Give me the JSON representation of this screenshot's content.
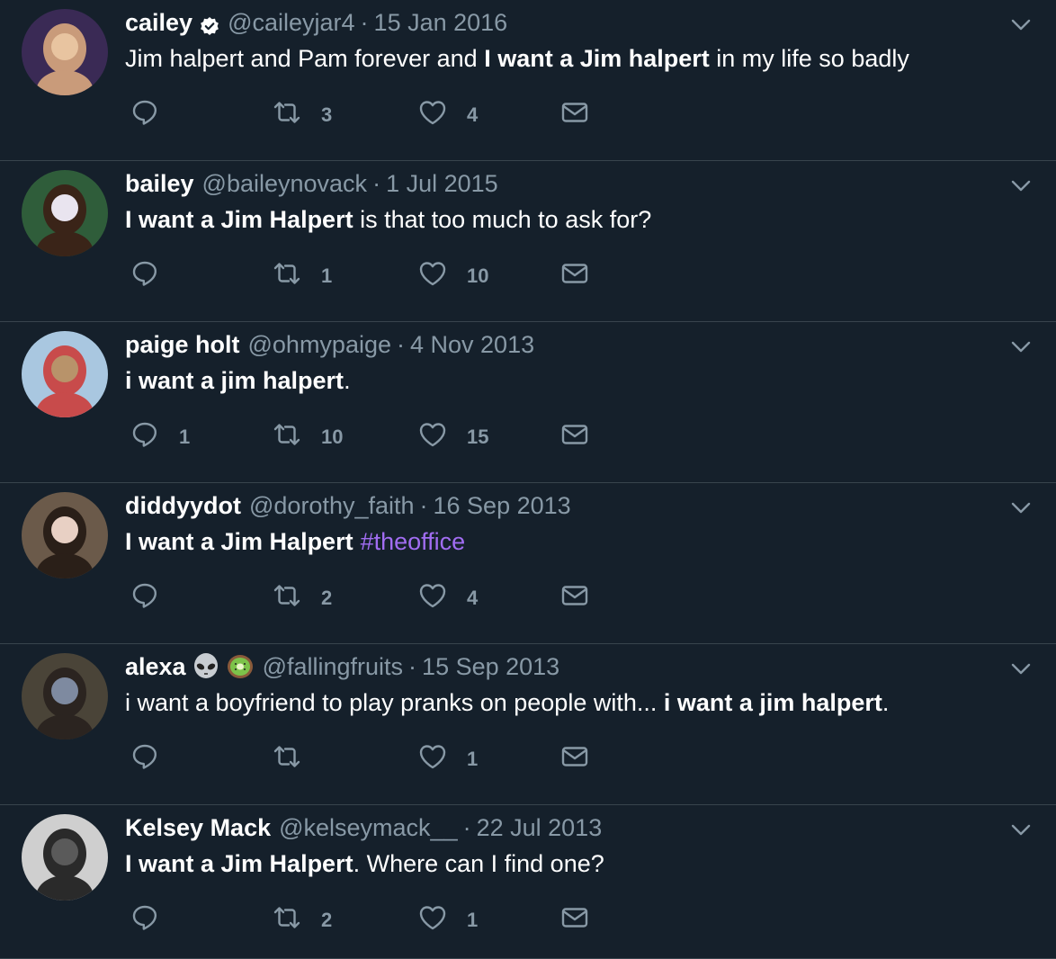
{
  "tweets": [
    {
      "name": "cailey",
      "verified": true,
      "emojis": [],
      "handle": "@caileyjar4",
      "date": "15 Jan 2016",
      "text": [
        {
          "t": "Jim halpert and Pam forever and ",
          "style": "normal"
        },
        {
          "t": "I want a Jim halpert",
          "style": "bold"
        },
        {
          "t": " in my life so badly",
          "style": "normal"
        }
      ],
      "replies": "",
      "retweets": "3",
      "likes": "4"
    },
    {
      "name": "bailey",
      "verified": false,
      "emojis": [],
      "handle": "@baileynovack",
      "date": "1 Jul 2015",
      "text": [
        {
          "t": "I want a Jim Halpert",
          "style": "bold"
        },
        {
          "t": " is that too much to ask for?",
          "style": "normal"
        }
      ],
      "replies": "",
      "retweets": "1",
      "likes": "10"
    },
    {
      "name": "paige holt",
      "verified": false,
      "emojis": [],
      "handle": "@ohmypaige",
      "date": "4 Nov 2013",
      "text": [
        {
          "t": "i want a jim halpert",
          "style": "bold"
        },
        {
          "t": ".",
          "style": "normal"
        }
      ],
      "replies": "1",
      "retweets": "10",
      "likes": "15"
    },
    {
      "name": "diddyydot",
      "verified": false,
      "emojis": [],
      "handle": "@dorothy_faith",
      "date": "16 Sep 2013",
      "text": [
        {
          "t": "I want a Jim Halpert",
          "style": "bold"
        },
        {
          "t": "#theoffice",
          "style": "hashtag"
        }
      ],
      "replies": "",
      "retweets": "2",
      "likes": "4"
    },
    {
      "name": "alexa",
      "verified": false,
      "emojis": [
        "alien-emoji",
        "kiwi-emoji"
      ],
      "handle": "@fallingfruits",
      "date": "15 Sep 2013",
      "text": [
        {
          "t": "i want a boyfriend to play pranks on people with... ",
          "style": "normal"
        },
        {
          "t": "i want a jim halpert",
          "style": "bold"
        },
        {
          "t": ".",
          "style": "normal"
        }
      ],
      "replies": "",
      "retweets": "",
      "likes": "1"
    },
    {
      "name": "Kelsey Mack",
      "verified": false,
      "emojis": [],
      "handle": "@kelseymack__",
      "date": "22 Jul 2013",
      "text": [
        {
          "t": "I want a Jim Halpert",
          "style": "bold"
        },
        {
          "t": ". Where can I find one?",
          "style": "normal"
        }
      ],
      "replies": "",
      "retweets": "2",
      "likes": "1"
    }
  ],
  "separator": "·",
  "icons": {
    "reply": "reply-icon",
    "retweet": "retweet-icon",
    "like": "heart-icon",
    "message": "envelope-icon",
    "menu": "chevron-down-icon",
    "verified": "verified-badge-icon"
  },
  "colors": {
    "background": "#15202b",
    "divider": "#38444d",
    "muted": "#8899a6",
    "hashtag": "#a16df2"
  }
}
